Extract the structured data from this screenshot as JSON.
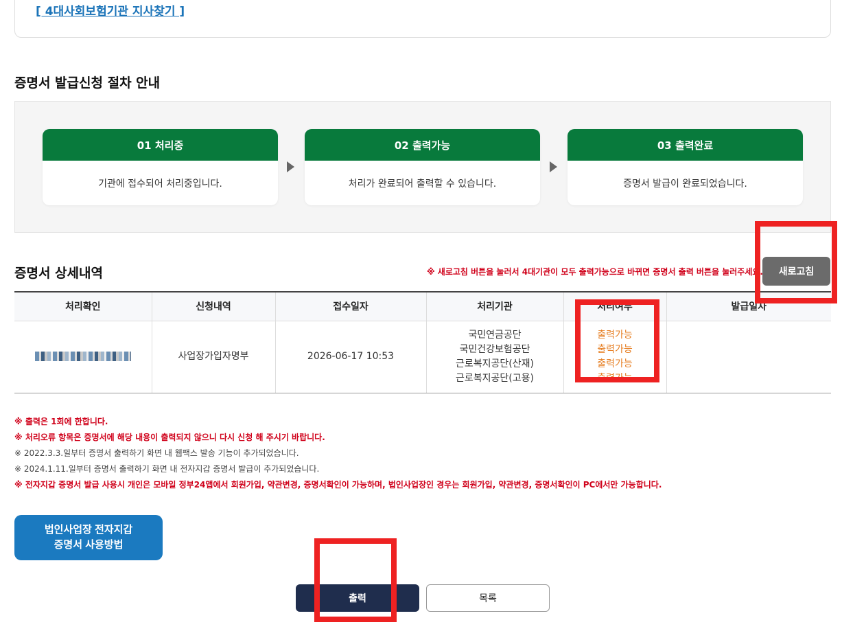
{
  "top": {
    "link_label": "[ 4대사회보험기관 지사찾기 ]"
  },
  "procedure": {
    "title": "증명서 발급신청 절차 안내",
    "steps": [
      {
        "head": "01 처리중",
        "body": "기관에 접수되어 처리중입니다."
      },
      {
        "head": "02 출력가능",
        "body": "처리가 완료되어 출력할 수 있습니다."
      },
      {
        "head": "03 출력완료",
        "body": "증명서 발급이 완료되었습니다."
      }
    ]
  },
  "detail": {
    "title": "증명서 상세내역",
    "notice": "※ 새로고침 버튼을 눌러서 4대기관이 모두 출력가능으로 바뀌면 증명서 출력 버튼을 눌러주세요.",
    "refresh_label": "새로고침",
    "columns": [
      "처리확인",
      "신청내역",
      "접수일자",
      "처리기관",
      "처리여부",
      "발급일자"
    ],
    "row": {
      "application": "사업장가입자명부",
      "date": "2026-06-17 10:53",
      "agencies": [
        "국민연금공단",
        "국민건강보험공단",
        "근로복지공단(산재)",
        "근로복지공단(고용)"
      ],
      "statuses": [
        "출력가능",
        "출력가능",
        "출력가능",
        "출력가능"
      ],
      "issue_date": ""
    }
  },
  "notes": [
    {
      "text": "※ 출력은 1회에 한합니다.",
      "red": true
    },
    {
      "text": "※ 처리오류 항목은 증명서에 해당 내용이 출력되지 않으니 다시 신청 해 주시기 바랍니다.",
      "red": true
    },
    {
      "text": "※ 2022.3.3.일부터 증명서 출력하기 화면 내 웹팩스 발송 기능이 추가되었습니다.",
      "red": false
    },
    {
      "text": "※ 2024.1.11.일부터 증명서 출력하기 화면 내 전자지갑 증명서 발급이 추가되었습니다.",
      "red": false
    },
    {
      "text": "※ 전자지갑 증명서 발급 사용시 개인은 모바일 정부24앱에서 회원가입, 약관변경, 증명서확인이 가능하며, 법인사업장인 경우는 회원가입, 약관변경, 증명서확인이 PC에서만 가능합니다.",
      "red": true
    }
  ],
  "guide_button": {
    "line1": "법인사업장 전자지갑",
    "line2": "증명서 사용방법"
  },
  "actions": {
    "print_label": "출력",
    "list_label": "목록"
  },
  "colors": {
    "step_green": "#087a3c",
    "print_navy": "#1f2d4d",
    "guide_blue": "#1b7ac0",
    "status_orange": "#e67e22",
    "notice_red": "#d0021b",
    "highlight_red": "#ee2222"
  }
}
